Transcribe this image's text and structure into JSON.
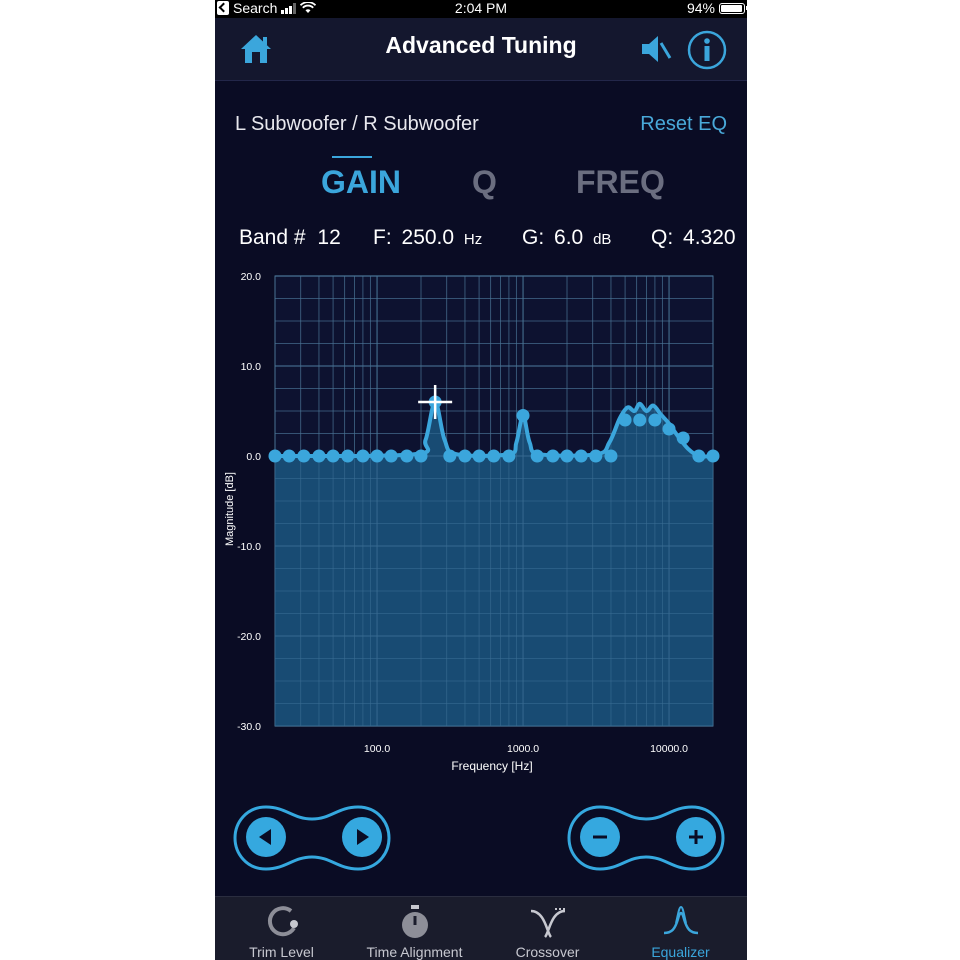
{
  "status_bar": {
    "back_app": "Search",
    "time": "2:04 PM",
    "battery": "94%"
  },
  "header": {
    "title": "Advanced Tuning"
  },
  "eq": {
    "channel_label": "L Subwoofer / R Subwoofer",
    "reset_label": "Reset EQ",
    "tabs": [
      {
        "label": "GAIN",
        "active": true
      },
      {
        "label": "Q",
        "active": false
      },
      {
        "label": "FREQ",
        "active": false
      }
    ],
    "band_label": "Band #",
    "band_value": "12",
    "freq_label": "F:",
    "freq_value": "250.0",
    "freq_unit": "Hz",
    "gain_label": "G:",
    "gain_value": "6.0",
    "gain_unit": "dB",
    "q_label": "Q:",
    "q_value": "4.320"
  },
  "chart_data": {
    "type": "line",
    "xlabel": "Frequency [Hz]",
    "ylabel": "Magnitude [dB]",
    "x_scale": "log",
    "xlim": [
      20,
      20000
    ],
    "ylim": [
      -30,
      20
    ],
    "y_ticks": [
      "20.0",
      "10.0",
      "0.0",
      "-10.0",
      "-20.0",
      "-30.0"
    ],
    "x_ticks": [
      {
        "value": 100,
        "label": "100.0"
      },
      {
        "value": 1000,
        "label": "1000.0"
      },
      {
        "value": 10000,
        "label": "10000.0"
      }
    ],
    "grid": true,
    "fill": "below-curve",
    "band_points": [
      {
        "f": 20,
        "g": 0
      },
      {
        "f": 25,
        "g": 0
      },
      {
        "f": 31.5,
        "g": 0
      },
      {
        "f": 40,
        "g": 0
      },
      {
        "f": 50,
        "g": 0
      },
      {
        "f": 63,
        "g": 0
      },
      {
        "f": 80,
        "g": 0
      },
      {
        "f": 100,
        "g": 0
      },
      {
        "f": 125,
        "g": 0
      },
      {
        "f": 160,
        "g": 0
      },
      {
        "f": 200,
        "g": 0
      },
      {
        "f": 250,
        "g": 6
      },
      {
        "f": 315,
        "g": 0
      },
      {
        "f": 400,
        "g": 0
      },
      {
        "f": 500,
        "g": 0
      },
      {
        "f": 630,
        "g": 0
      },
      {
        "f": 800,
        "g": 0
      },
      {
        "f": 1000,
        "g": 4.5
      },
      {
        "f": 1250,
        "g": 0
      },
      {
        "f": 1600,
        "g": 0
      },
      {
        "f": 2000,
        "g": 0
      },
      {
        "f": 2500,
        "g": 0
      },
      {
        "f": 3150,
        "g": 0
      },
      {
        "f": 4000,
        "g": 0
      },
      {
        "f": 5000,
        "g": 4
      },
      {
        "f": 6300,
        "g": 4
      },
      {
        "f": 8000,
        "g": 4
      },
      {
        "f": 10000,
        "g": 3
      },
      {
        "f": 12500,
        "g": 2
      },
      {
        "f": 16000,
        "g": 0
      },
      {
        "f": 20000,
        "g": 0
      }
    ],
    "curve": [
      {
        "f": 20,
        "g": 0
      },
      {
        "f": 180,
        "g": 0.2
      },
      {
        "f": 215,
        "g": 1.8
      },
      {
        "f": 250,
        "g": 6
      },
      {
        "f": 290,
        "g": 1.8
      },
      {
        "f": 350,
        "g": 0.2
      },
      {
        "f": 800,
        "g": 0.2
      },
      {
        "f": 900,
        "g": 1.5
      },
      {
        "f": 1000,
        "g": 4.5
      },
      {
        "f": 1110,
        "g": 1.5
      },
      {
        "f": 1300,
        "g": 0.2
      },
      {
        "f": 3200,
        "g": 0.2
      },
      {
        "f": 3900,
        "g": 1.5
      },
      {
        "f": 4600,
        "g": 4.2
      },
      {
        "f": 5200,
        "g": 5.4
      },
      {
        "f": 5800,
        "g": 5.0
      },
      {
        "f": 6300,
        "g": 5.8
      },
      {
        "f": 7000,
        "g": 5.0
      },
      {
        "f": 7800,
        "g": 5.6
      },
      {
        "f": 8800,
        "g": 4.6
      },
      {
        "f": 10000,
        "g": 3.6
      },
      {
        "f": 11500,
        "g": 2.2
      },
      {
        "f": 13500,
        "g": 0.8
      },
      {
        "f": 16000,
        "g": 0
      },
      {
        "f": 20000,
        "g": 0
      }
    ],
    "selected_band": {
      "f": 250,
      "g": 6
    }
  },
  "tab_bar": {
    "items": [
      {
        "label": "Trim Level",
        "icon": "trim-level-icon"
      },
      {
        "label": "Time Alignment",
        "icon": "stopwatch-icon"
      },
      {
        "label": "Crossover",
        "icon": "crossover-icon"
      },
      {
        "label": "Equalizer",
        "icon": "equalizer-icon"
      }
    ],
    "active_index": 3
  },
  "colors": {
    "background": "#0a0c24",
    "accent": "#3ba6dc",
    "chart_fill": "#1c5b86",
    "grid": "#4a7494"
  }
}
